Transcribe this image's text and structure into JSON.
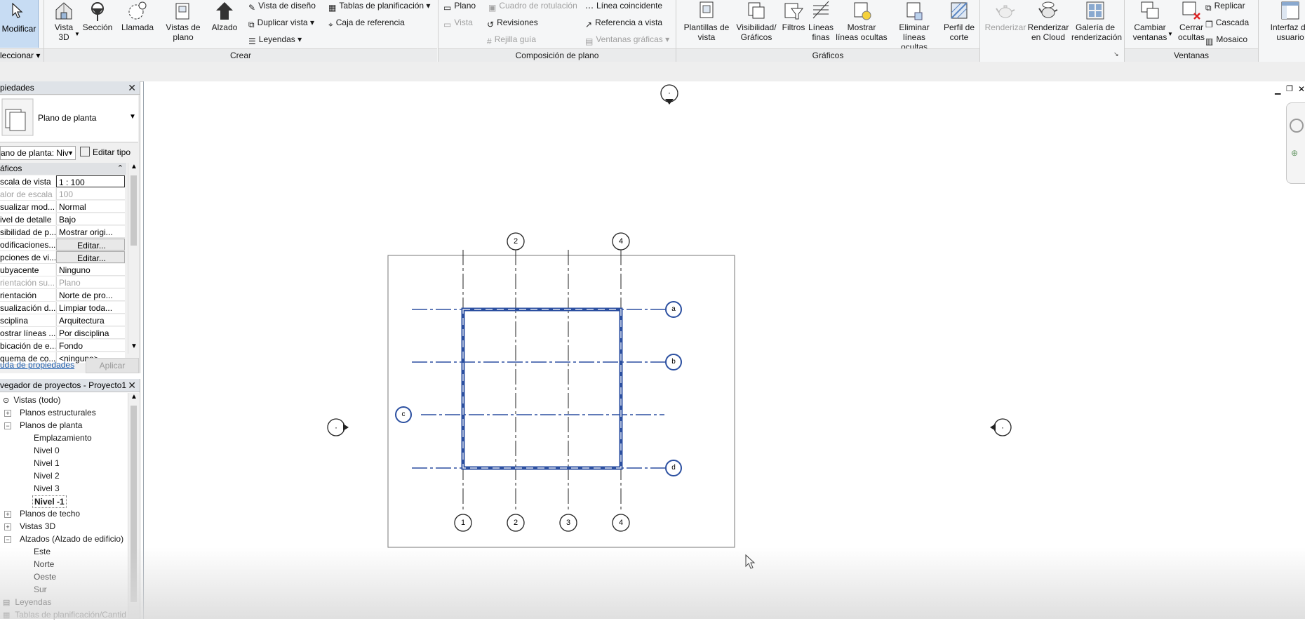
{
  "ribbon": {
    "modify": {
      "label": "Modificar",
      "sub": "leccionar"
    },
    "crear": {
      "panel": "Crear",
      "vista3d": "Vista 3D",
      "seccion": "Sección",
      "llamada": "Llamada",
      "vistas_plano": "Vistas de plano",
      "alzado": "Alzado",
      "vista_diseno": "Vista de diseño",
      "duplicar_vista": "Duplicar vista",
      "leyendas": "Leyendas",
      "tablas_planificacion": "Tablas de planificación",
      "caja_referencia": "Caja de referencia"
    },
    "composicion": {
      "panel": "Composición de plano",
      "plano": "Plano",
      "cuadro_rotulacion": "Cuadro de rotulación",
      "vista": "Vista",
      "revisiones": "Revisiones",
      "rejilla_guia": "Rejilla guía",
      "linea_coincidente": "Línea coincidente",
      "referencia_vista": "Referencia a vista",
      "ventanas_graficas": "Ventanas gráficas"
    },
    "graficos": {
      "panel": "Gráficos",
      "plantillas_vista": "Plantillas de vista",
      "visibilidad_graficos": "Visibilidad/ Gráficos",
      "filtros": "Filtros",
      "lineas_finas": "Líneas finas",
      "mostrar_lineas_ocultas": "Mostrar líneas ocultas",
      "eliminar_lineas_ocultas": "Eliminar líneas ocultas",
      "perfil_corte": "Perfil de corte"
    },
    "render": {
      "renderizar": "Renderizar",
      "renderizar_cloud": "Renderizar en Cloud",
      "galeria": "Galería de renderización"
    },
    "ventanas": {
      "panel": "Ventanas",
      "cambiar_ventanas": "Cambiar ventanas",
      "cerrar_ocultas": "Cerrar ocultas",
      "replicar": "Replicar",
      "cascada": "Cascada",
      "mosaico": "Mosaico",
      "interfaz_usuario": "Interfaz de usuario"
    }
  },
  "properties": {
    "title": "piedades",
    "type_name": "Plano de planta",
    "selector_value": "ano de planta: Niv",
    "edit_type": "Editar tipo",
    "section": "áficos",
    "rows": [
      {
        "key": "scala de vista",
        "value": "1 : 100"
      },
      {
        "key": "alor de escala ...",
        "value": "100"
      },
      {
        "key": "sualizar mod...",
        "value": "Normal"
      },
      {
        "key": "ivel de detalle",
        "value": "Bajo"
      },
      {
        "key": "sibilidad de p...",
        "value": "Mostrar origi..."
      },
      {
        "key": "odificaciones...",
        "value": "Editar..."
      },
      {
        "key": "pciones de vi...",
        "value": "Editar..."
      },
      {
        "key": "ubyacente",
        "value": "Ninguno"
      },
      {
        "key": "rientación su...",
        "value": "Plano"
      },
      {
        "key": "rientación",
        "value": "Norte de pro..."
      },
      {
        "key": "sualización d...",
        "value": "Limpiar toda..."
      },
      {
        "key": "sciplina",
        "value": "Arquitectura"
      },
      {
        "key": "ostrar líneas ...",
        "value": "Por disciplina"
      },
      {
        "key": "bicación de e...",
        "value": "Fondo"
      },
      {
        "key": "quema de co...",
        "value": "<ninguno>"
      }
    ],
    "help_link": "uda de propiedades",
    "apply": "Aplicar"
  },
  "browser": {
    "title": "vegador de proyectos - Proyecto1",
    "items": {
      "vistas": "Vistas (todo)",
      "estructurales": "Planos estructurales",
      "planta": "Planos de planta",
      "emplazamiento": "Emplazamiento",
      "nivel0": "Nivel 0",
      "nivel1": "Nivel 1",
      "nivel2": "Nivel 2",
      "nivel3": "Nivel 3",
      "nivelm1": "Nivel -1",
      "techo": "Planos de techo",
      "vistas3d": "Vistas 3D",
      "alzados": "Alzados (Alzado de edificio)",
      "este": "Este",
      "norte": "Norte",
      "oeste": "Oeste",
      "sur": "Sur",
      "leyendas": "Leyendas",
      "tablas": "Tablas de planificación/Cantid"
    }
  },
  "drawing": {
    "grid_top": [
      "2",
      "4"
    ],
    "grid_bottom": [
      "1",
      "2",
      "3",
      "4"
    ],
    "grid_right": [
      "a",
      "b",
      "d"
    ],
    "grid_left": [
      "c"
    ],
    "marker": "·"
  },
  "colors": {
    "accent": "#2b4fa0",
    "ribbon_bg": "#f5f6f7"
  }
}
